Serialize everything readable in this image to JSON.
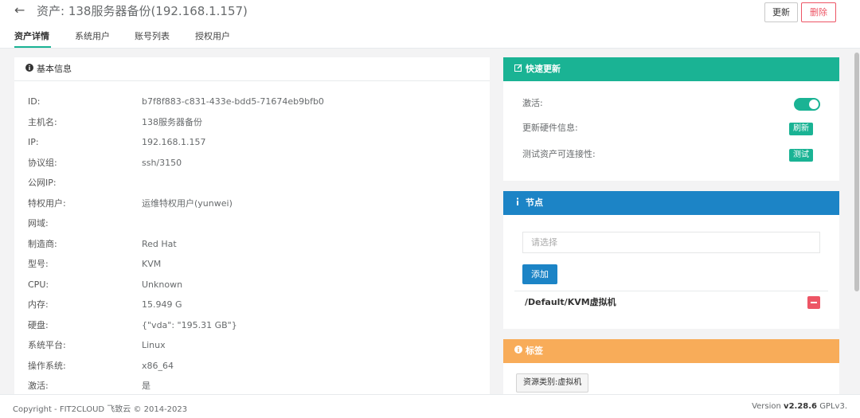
{
  "header": {
    "back_icon": "arrow-left-icon",
    "title": "资产: 138服务器备份(192.168.1.157)",
    "update_label": "更新",
    "delete_label": "删除"
  },
  "tabs": [
    {
      "label": "资产详情",
      "active": true
    },
    {
      "label": "系统用户",
      "active": false
    },
    {
      "label": "账号列表",
      "active": false
    },
    {
      "label": "授权用户",
      "active": false
    }
  ],
  "basic_info": {
    "title": "基本信息",
    "icon": "info-circle-icon",
    "rows": [
      {
        "label": "ID:",
        "value": "b7f8f883-c831-433e-bdd5-71674eb9bfb0"
      },
      {
        "label": "主机名:",
        "value": "138服务器备份"
      },
      {
        "label": "IP:",
        "value": "192.168.1.157"
      },
      {
        "label": "协议组:",
        "value": "ssh/3150"
      },
      {
        "label": "公网IP:",
        "value": ""
      },
      {
        "label": "特权用户:",
        "value": "运维特权用户(yunwei)"
      },
      {
        "label": "网域:",
        "value": ""
      },
      {
        "label": "制造商:",
        "value": "Red Hat"
      },
      {
        "label": "型号:",
        "value": "KVM"
      },
      {
        "label": "CPU:",
        "value": "Unknown"
      },
      {
        "label": "内存:",
        "value": "15.949 G"
      },
      {
        "label": "硬盘:",
        "value": "{\"vda\": \"195.31 GB\"}"
      },
      {
        "label": "系统平台:",
        "value": "Linux"
      },
      {
        "label": "操作系统:",
        "value": "x86_64"
      },
      {
        "label": "激活:",
        "value": "是"
      }
    ]
  },
  "quick_update": {
    "title": "快速更新",
    "icon": "edit-icon",
    "active_label": "激活:",
    "active_on": true,
    "hardware_label": "更新硬件信息:",
    "refresh_label": "刷新",
    "test_label": "测试资产可连接性:",
    "test_button": "测试"
  },
  "nodes": {
    "title": "节点",
    "icon": "info-icon",
    "select_placeholder": "请选择",
    "add_label": "添加",
    "node_path": "/Default/KVM虚拟机"
  },
  "labels": {
    "title": "标签",
    "icon": "info-circle-icon",
    "tag": "资源类别:虚拟机"
  },
  "footer": {
    "copyright": "Copyright - FIT2CLOUD 飞致云 © 2014-2023",
    "version_prefix": "Version",
    "version": "v2.28.6",
    "license": "GPLv3."
  },
  "colors": {
    "green": "#1ab394",
    "blue": "#1c84c6",
    "orange": "#f8ac59",
    "red": "#ed5565"
  }
}
